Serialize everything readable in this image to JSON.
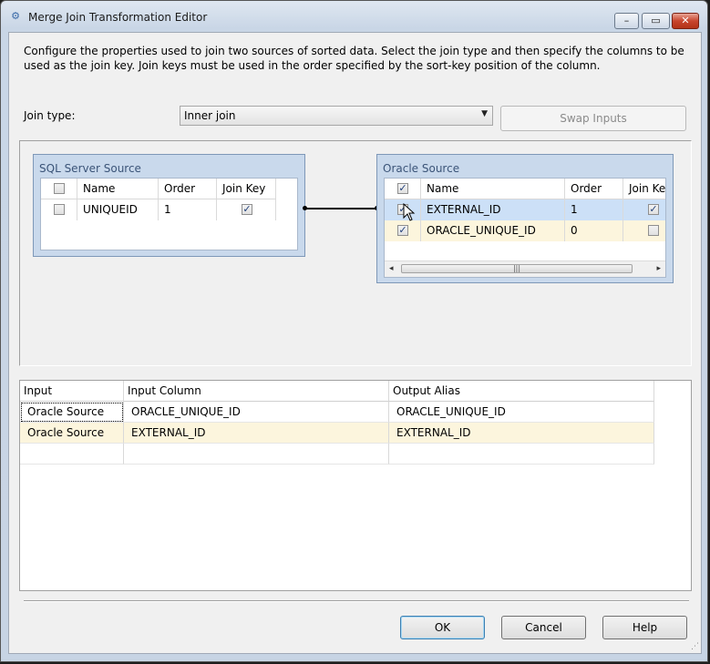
{
  "window": {
    "title": "Merge Join Transformation Editor",
    "minimize_glyph": "–",
    "maximize_glyph": "▭",
    "close_glyph": "✕"
  },
  "description": "Configure the properties used to join two sources of sorted data. Select the join type and then specify the columns to be used as the join key. Join keys must be used in the order specified by the sort-key position of the column.",
  "join_type": {
    "label": "Join type:",
    "value": "Inner join"
  },
  "swap_button": "Swap Inputs",
  "left_source": {
    "title": "SQL Server Source",
    "headers": [
      "Name",
      "Order",
      "Join Key"
    ],
    "rows": [
      {
        "name": "UNIQUEID",
        "order": "1",
        "selected": false,
        "join_key": true
      }
    ]
  },
  "right_source": {
    "title": "Oracle Source",
    "headers": [
      "Name",
      "Order",
      "Join Key"
    ],
    "rows": [
      {
        "name": "EXTERNAL_ID",
        "order": "1",
        "selected": true,
        "join_key": true
      },
      {
        "name": "ORACLE_UNIQUE_ID",
        "order": "0",
        "selected": true,
        "join_key": false
      }
    ]
  },
  "output_grid": {
    "headers": [
      "Input",
      "Input Column",
      "Output Alias"
    ],
    "rows": [
      {
        "input": "Oracle Source",
        "input_column": "ORACLE_UNIQUE_ID",
        "output_alias": "ORACLE_UNIQUE_ID"
      },
      {
        "input": "Oracle Source",
        "input_column": "EXTERNAL_ID",
        "output_alias": "EXTERNAL_ID"
      }
    ]
  },
  "buttons": {
    "ok": "OK",
    "cancel": "Cancel",
    "help": "Help"
  },
  "icons": {
    "app": "gear-icon",
    "dropdown": "chevron-down-icon",
    "scroll_left": "arrow-left-icon",
    "scroll_right": "arrow-right-icon",
    "cursor": "mouse-pointer-icon"
  }
}
